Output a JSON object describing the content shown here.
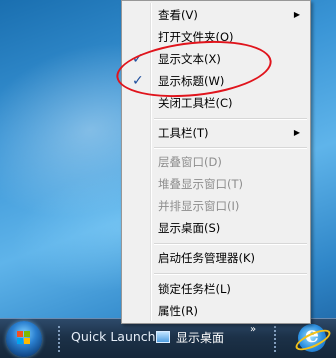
{
  "menu": {
    "items": [
      {
        "label": "查看(V)",
        "submenu": true,
        "disabled": false,
        "checked": false
      },
      {
        "label": "打开文件夹(O)",
        "submenu": false,
        "disabled": false,
        "checked": false
      },
      {
        "label": "显示文本(X)",
        "submenu": false,
        "disabled": false,
        "checked": true
      },
      {
        "label": "显示标题(W)",
        "submenu": false,
        "disabled": false,
        "checked": true
      },
      {
        "label": "关闭工具栏(C)",
        "submenu": false,
        "disabled": false,
        "checked": false
      },
      {
        "label": "工具栏(T)",
        "submenu": true,
        "disabled": false,
        "checked": false
      },
      {
        "label": "层叠窗口(D)",
        "submenu": false,
        "disabled": true,
        "checked": false
      },
      {
        "label": "堆叠显示窗口(T)",
        "submenu": false,
        "disabled": true,
        "checked": false
      },
      {
        "label": "并排显示窗口(I)",
        "submenu": false,
        "disabled": true,
        "checked": false
      },
      {
        "label": "显示桌面(S)",
        "submenu": false,
        "disabled": false,
        "checked": false
      },
      {
        "label": "启动任务管理器(K)",
        "submenu": false,
        "disabled": false,
        "checked": false
      },
      {
        "label": "锁定任务栏(L)",
        "submenu": false,
        "disabled": false,
        "checked": false
      },
      {
        "label": "属性(R)",
        "submenu": false,
        "disabled": false,
        "checked": false
      }
    ],
    "check_glyph": "✓",
    "arrow_glyph": "▶"
  },
  "highlight": {
    "color": "#e0141c"
  },
  "taskbar": {
    "quick_launch_label": "Quick Launch",
    "desktop_button_label": "显示桌面",
    "chevron": "»",
    "icons": [
      "start-orb-icon",
      "show-desktop-icon",
      "internet-explorer-icon"
    ]
  }
}
